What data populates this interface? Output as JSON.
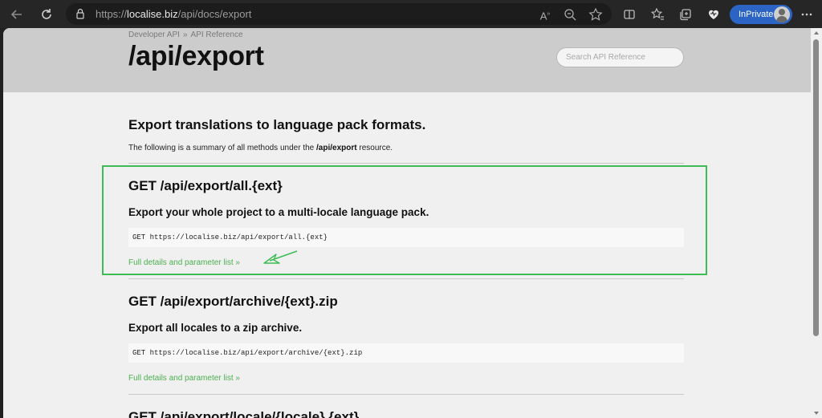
{
  "browser": {
    "url_prefix": "https://",
    "url_host": "localise.biz",
    "url_path": "/api/docs/export",
    "profile_label": "InPrivate",
    "icons": [
      "back-icon",
      "refresh-icon",
      "lock-icon",
      "read-aloud-icon",
      "zoom-icon",
      "favorite-icon",
      "split-screen-icon",
      "favorites-icon",
      "collections-icon",
      "health-icon",
      "more-icon"
    ]
  },
  "page": {
    "breadcrumb": [
      "Developer API",
      "API Reference"
    ],
    "breadcrumb_sep": "»",
    "title": "/api/export",
    "search_placeholder": "Search API Reference",
    "intro_heading": "Export translations to language pack formats.",
    "intro_text_before": "The following is a summary of all methods under the",
    "intro_text_code": "/api/export",
    "intro_text_after": "resource.",
    "sections": [
      {
        "heading": "GET /api/export/all.{ext}",
        "summary": "Export your whole project to a multi-locale language pack.",
        "code": "GET https://localise.biz/api/export/all.{ext}",
        "link": "Full details and parameter list »"
      },
      {
        "heading": "GET /api/export/archive/{ext}.zip",
        "summary": "Export all locales to a zip archive.",
        "code": "GET https://localise.biz/api/export/archive/{ext}.zip",
        "link": "Full details and parameter list »"
      },
      {
        "heading": "GET /api/export/locale/{locale}.{ext}"
      }
    ]
  },
  "annotation": {
    "highlight_color": "#3dbb54"
  }
}
